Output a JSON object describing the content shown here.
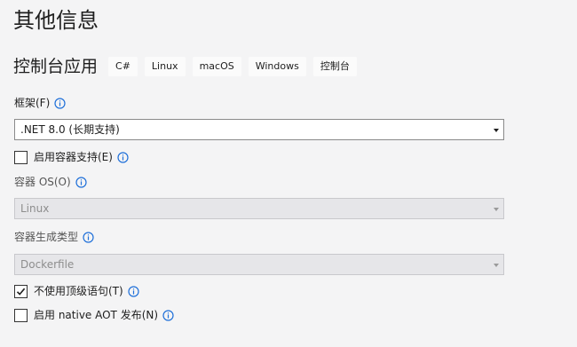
{
  "page": {
    "title": "其他信息"
  },
  "project": {
    "name": "控制台应用",
    "tags": [
      "C#",
      "Linux",
      "macOS",
      "Windows",
      "控制台"
    ]
  },
  "framework": {
    "label": "框架(F)",
    "value": ".NET 8.0 (长期支持)"
  },
  "container_support": {
    "label": "启用容器支持(E)",
    "checked": false
  },
  "container_os": {
    "label": "容器 OS(O)",
    "value": "Linux",
    "disabled": true
  },
  "container_build_type": {
    "label": "容器生成类型",
    "value": "Dockerfile",
    "disabled": true
  },
  "top_level_statements": {
    "label": "不使用顶级语句(T)",
    "checked": true
  },
  "native_aot": {
    "label": "启用 native AOT 发布(N)",
    "checked": false
  },
  "colors": {
    "info": "#1e6fd9",
    "background": "#f4f4f5"
  }
}
